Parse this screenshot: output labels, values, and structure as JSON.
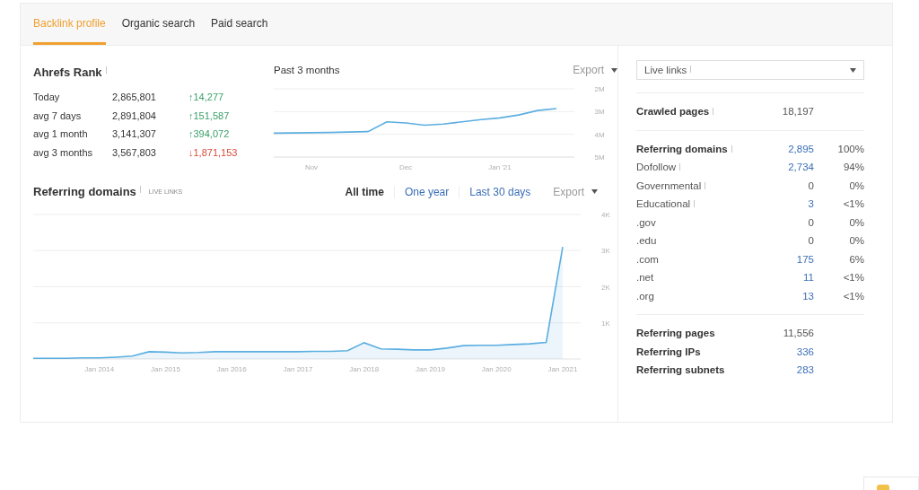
{
  "tabs": [
    {
      "label": "Backlink profile",
      "selected": true
    },
    {
      "label": "Organic search",
      "selected": false
    },
    {
      "label": "Paid search",
      "selected": false
    }
  ],
  "ahrefs_rank": {
    "title": "Ahrefs Rank",
    "info": true,
    "period": "Past 3 months",
    "export": "Export",
    "rows": [
      {
        "label": "Today",
        "value": "2,865,801",
        "change": "↑14,277",
        "kind": "up"
      },
      {
        "label": "avg 7 days",
        "value": "2,891,804",
        "change": "↑151,587",
        "kind": "up"
      },
      {
        "label": "avg 1 month",
        "value": "3,141,307",
        "change": "↑394,072",
        "kind": "up"
      },
      {
        "label": "avg 3 months",
        "value": "3,567,803",
        "change": "↓1,871,153",
        "kind": "down"
      }
    ],
    "chart_data": {
      "type": "line",
      "grid": true,
      "categories": [
        null,
        null,
        "Nov",
        null,
        null,
        null,
        null,
        "Dec",
        null,
        null,
        null,
        null,
        "Jan '21",
        null,
        null,
        null
      ],
      "series": [
        {
          "color": "#5aaee0",
          "values": [
            3950000,
            3940000,
            3930000,
            3920000,
            3900000,
            3880000,
            3450000,
            3500000,
            3600000,
            3550000,
            3450000,
            3350000,
            3280000,
            3150000,
            2950000,
            2870000
          ]
        }
      ],
      "ylim": [
        5000000,
        2000000
      ],
      "yticks": [
        {
          "value": 2000000,
          "label": "2M"
        },
        {
          "value": 3000000,
          "label": "3M"
        },
        {
          "value": 4000000,
          "label": "4M"
        },
        {
          "value": 5000000,
          "label": "5M"
        }
      ]
    }
  },
  "referring_domains": {
    "title": "Referring domains",
    "info": true,
    "badge": "LIVE LINKS",
    "export": "Export",
    "ranges": [
      {
        "label": "All time",
        "selected": true
      },
      {
        "label": "One year",
        "selected": false
      },
      {
        "label": "Last 30 days",
        "selected": false
      }
    ],
    "chart_data": {
      "type": "area",
      "grid": true,
      "categories": [
        null,
        null,
        null,
        null,
        "Jan 2014",
        null,
        null,
        null,
        "Jan 2015",
        null,
        null,
        null,
        "Jan 2016",
        null,
        null,
        null,
        "Jan 2017",
        null,
        null,
        null,
        "Jan 2018",
        null,
        null,
        null,
        "Jan 2019",
        null,
        null,
        null,
        "Jan 2020",
        null,
        null,
        null,
        "Jan 2021"
      ],
      "series": [
        {
          "color": "#5aaee0",
          "values": [
            20,
            20,
            20,
            30,
            30,
            50,
            80,
            200,
            190,
            170,
            180,
            200,
            200,
            200,
            200,
            200,
            200,
            210,
            210,
            230,
            450,
            280,
            270,
            250,
            250,
            300,
            370,
            380,
            380,
            400,
            420,
            460,
            3100
          ]
        }
      ],
      "ylim": [
        0,
        4000
      ],
      "yticks": [
        {
          "value": 1000,
          "label": "1K"
        },
        {
          "value": 2000,
          "label": "2K"
        },
        {
          "value": 3000,
          "label": "3K"
        },
        {
          "value": 4000,
          "label": "4K"
        }
      ]
    }
  },
  "sidebar": {
    "dropdown": {
      "value": "Live links",
      "info": true
    },
    "groups": [
      [
        {
          "label": "Crawled pages",
          "value": "18,197",
          "bold": true,
          "linked": false,
          "info": true
        }
      ],
      [
        {
          "label": "Referring domains",
          "value": "2,895",
          "percent": "100%",
          "bold": true,
          "linked": true,
          "info": true
        },
        {
          "label": "Dofollow",
          "value": "2,734",
          "percent": "94%",
          "bold": false,
          "linked": true,
          "info": true
        },
        {
          "label": "Governmental",
          "value": "0",
          "percent": "0%",
          "bold": false,
          "linked": false,
          "info": true
        },
        {
          "label": "Educational",
          "value": "3",
          "percent": "<1%",
          "bold": false,
          "linked": true,
          "info": true
        },
        {
          "label": ".gov",
          "value": "0",
          "percent": "0%",
          "bold": false,
          "linked": false,
          "info": false
        },
        {
          "label": ".edu",
          "value": "0",
          "percent": "0%",
          "bold": false,
          "linked": false,
          "info": false
        },
        {
          "label": ".com",
          "value": "175",
          "percent": "6%",
          "bold": false,
          "linked": true,
          "info": false
        },
        {
          "label": ".net",
          "value": "11",
          "percent": "<1%",
          "bold": false,
          "linked": true,
          "info": false
        },
        {
          "label": ".org",
          "value": "13",
          "percent": "<1%",
          "bold": false,
          "linked": true,
          "info": false
        }
      ],
      [
        {
          "label": "Referring pages",
          "value": "11,556",
          "bold": true,
          "linked": false,
          "info": false
        },
        {
          "label": "Referring IPs",
          "value": "336",
          "bold": true,
          "linked": true,
          "info": false
        },
        {
          "label": "Referring subnets",
          "value": "283",
          "bold": true,
          "linked": true,
          "info": false
        }
      ]
    ]
  }
}
